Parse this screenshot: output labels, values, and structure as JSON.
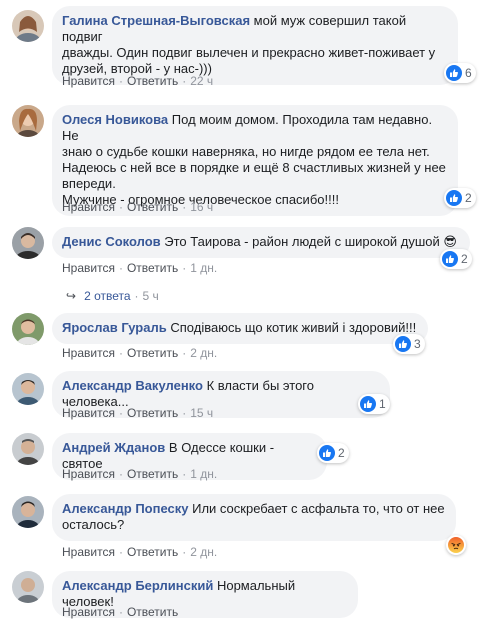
{
  "colors": {
    "name_link": "#385898",
    "bubble_bg": "#f2f3f5",
    "meta_gray": "#90949c",
    "like_blue": "#1877f2",
    "angry_orange": "#f0612a"
  },
  "actions": {
    "like": "Нравится",
    "reply": "Ответить",
    "separator": "·"
  },
  "comments": [
    {
      "name": "Галина Стрешная-Выговская",
      "lines": [
        "мой муж совершил такой подвиг",
        "дважды. Один подвиг вылечен и прекрасно живет-поживает у",
        "друзей, второй - у нас-)))"
      ],
      "time": "22 ч",
      "reaction_icon": "like-icon",
      "reaction_count": "6"
    },
    {
      "name": "Олеся Новикова",
      "lines": [
        "Под моим домом. Проходила там недавно. Не",
        "знаю о судьбе кошки наверняка, но нигде рядом ее тела нет.",
        "Надеюсь с ней все в порядке и ещё 8 счастливых жизней у нее",
        "впереди.",
        "Мужчине - огромное человеческое спасибо!!!!"
      ],
      "time": "16 ч",
      "reaction_icon": "like-icon",
      "reaction_count": "2"
    },
    {
      "name": "Денис Соколов",
      "lines": [
        "Это Таирова - район людей с широкой душой 😎"
      ],
      "time": "1 дн.",
      "reaction_icon": "like-icon",
      "reaction_count": "2",
      "replies": {
        "label": "2 ответа",
        "time": "5 ч"
      }
    },
    {
      "name": "Ярослав Гураль",
      "lines": [
        "Сподіваюсь що котик живий і здоровий!!!"
      ],
      "time": "2 дн.",
      "reaction_icon": "like-icon",
      "reaction_count": "3"
    },
    {
      "name": "Александр Вакуленко",
      "lines": [
        "К власти бы этого человека..."
      ],
      "time": "15 ч",
      "reaction_icon": "like-icon",
      "reaction_count": "1"
    },
    {
      "name": "Андрей Жданов",
      "lines": [
        "В Одессе кошки - святое"
      ],
      "time": "1 дн.",
      "reaction_icon": "like-icon",
      "reaction_count": "2"
    },
    {
      "name": "Александр Попеску",
      "lines": [
        "Или соскребает с асфальта то, что от нее",
        "осталось?"
      ],
      "time": "2 дн.",
      "reaction_icon": "angry-icon",
      "reaction_count": ""
    },
    {
      "name": "Александр Берлинский",
      "lines": [
        "Нормальный человек!"
      ],
      "time": "",
      "reaction_icon": "",
      "reaction_count": ""
    }
  ]
}
